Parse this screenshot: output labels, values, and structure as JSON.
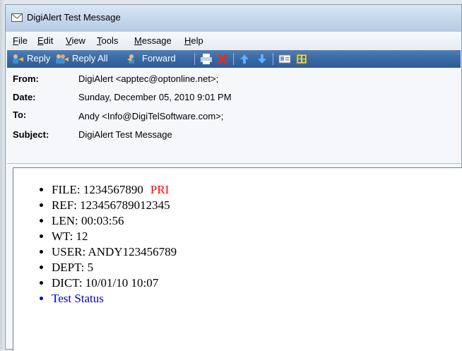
{
  "window": {
    "title": "DigiAlert Test Message"
  },
  "menu": [
    {
      "label": "File",
      "u": "F",
      "rest": "ile"
    },
    {
      "label": "Edit",
      "u": "E",
      "rest": "dit"
    },
    {
      "label": "View",
      "u": "V",
      "rest": "iew"
    },
    {
      "label": "Tools",
      "u": "T",
      "rest": "ools"
    },
    {
      "label": "Message",
      "u": "M",
      "rest": "essage"
    },
    {
      "label": "Help",
      "u": "H",
      "rest": "elp"
    }
  ],
  "toolbar": {
    "reply_label": "Reply",
    "reply_all_label": "Reply All",
    "forward_label": "Forward"
  },
  "header": {
    "from_label": "From:",
    "from_value": "DigiAlert <apptec@optonline.net>;",
    "date_label": "Date:",
    "date_value": "Sunday, December 05, 2010 9:01 PM",
    "to_label": "To:",
    "to_value": "Andy <Info@DigiTelSoftware.com>;",
    "subject_label": "Subject:",
    "subject_value": "DigiAlert Test Message"
  },
  "body": {
    "file_text": "FILE: 1234567890",
    "priority": "PRI",
    "ref": "REF: 123456789012345",
    "len": "LEN: 00:03:56",
    "wt": "WT: 12",
    "user": "USER: ANDY123456789",
    "dept": "DEPT: 5",
    "dict": "DICT: 10/01/10 10:07",
    "status_link": "Test Status",
    "priority_color": "#ff0000",
    "link_color": "#0000cc"
  }
}
